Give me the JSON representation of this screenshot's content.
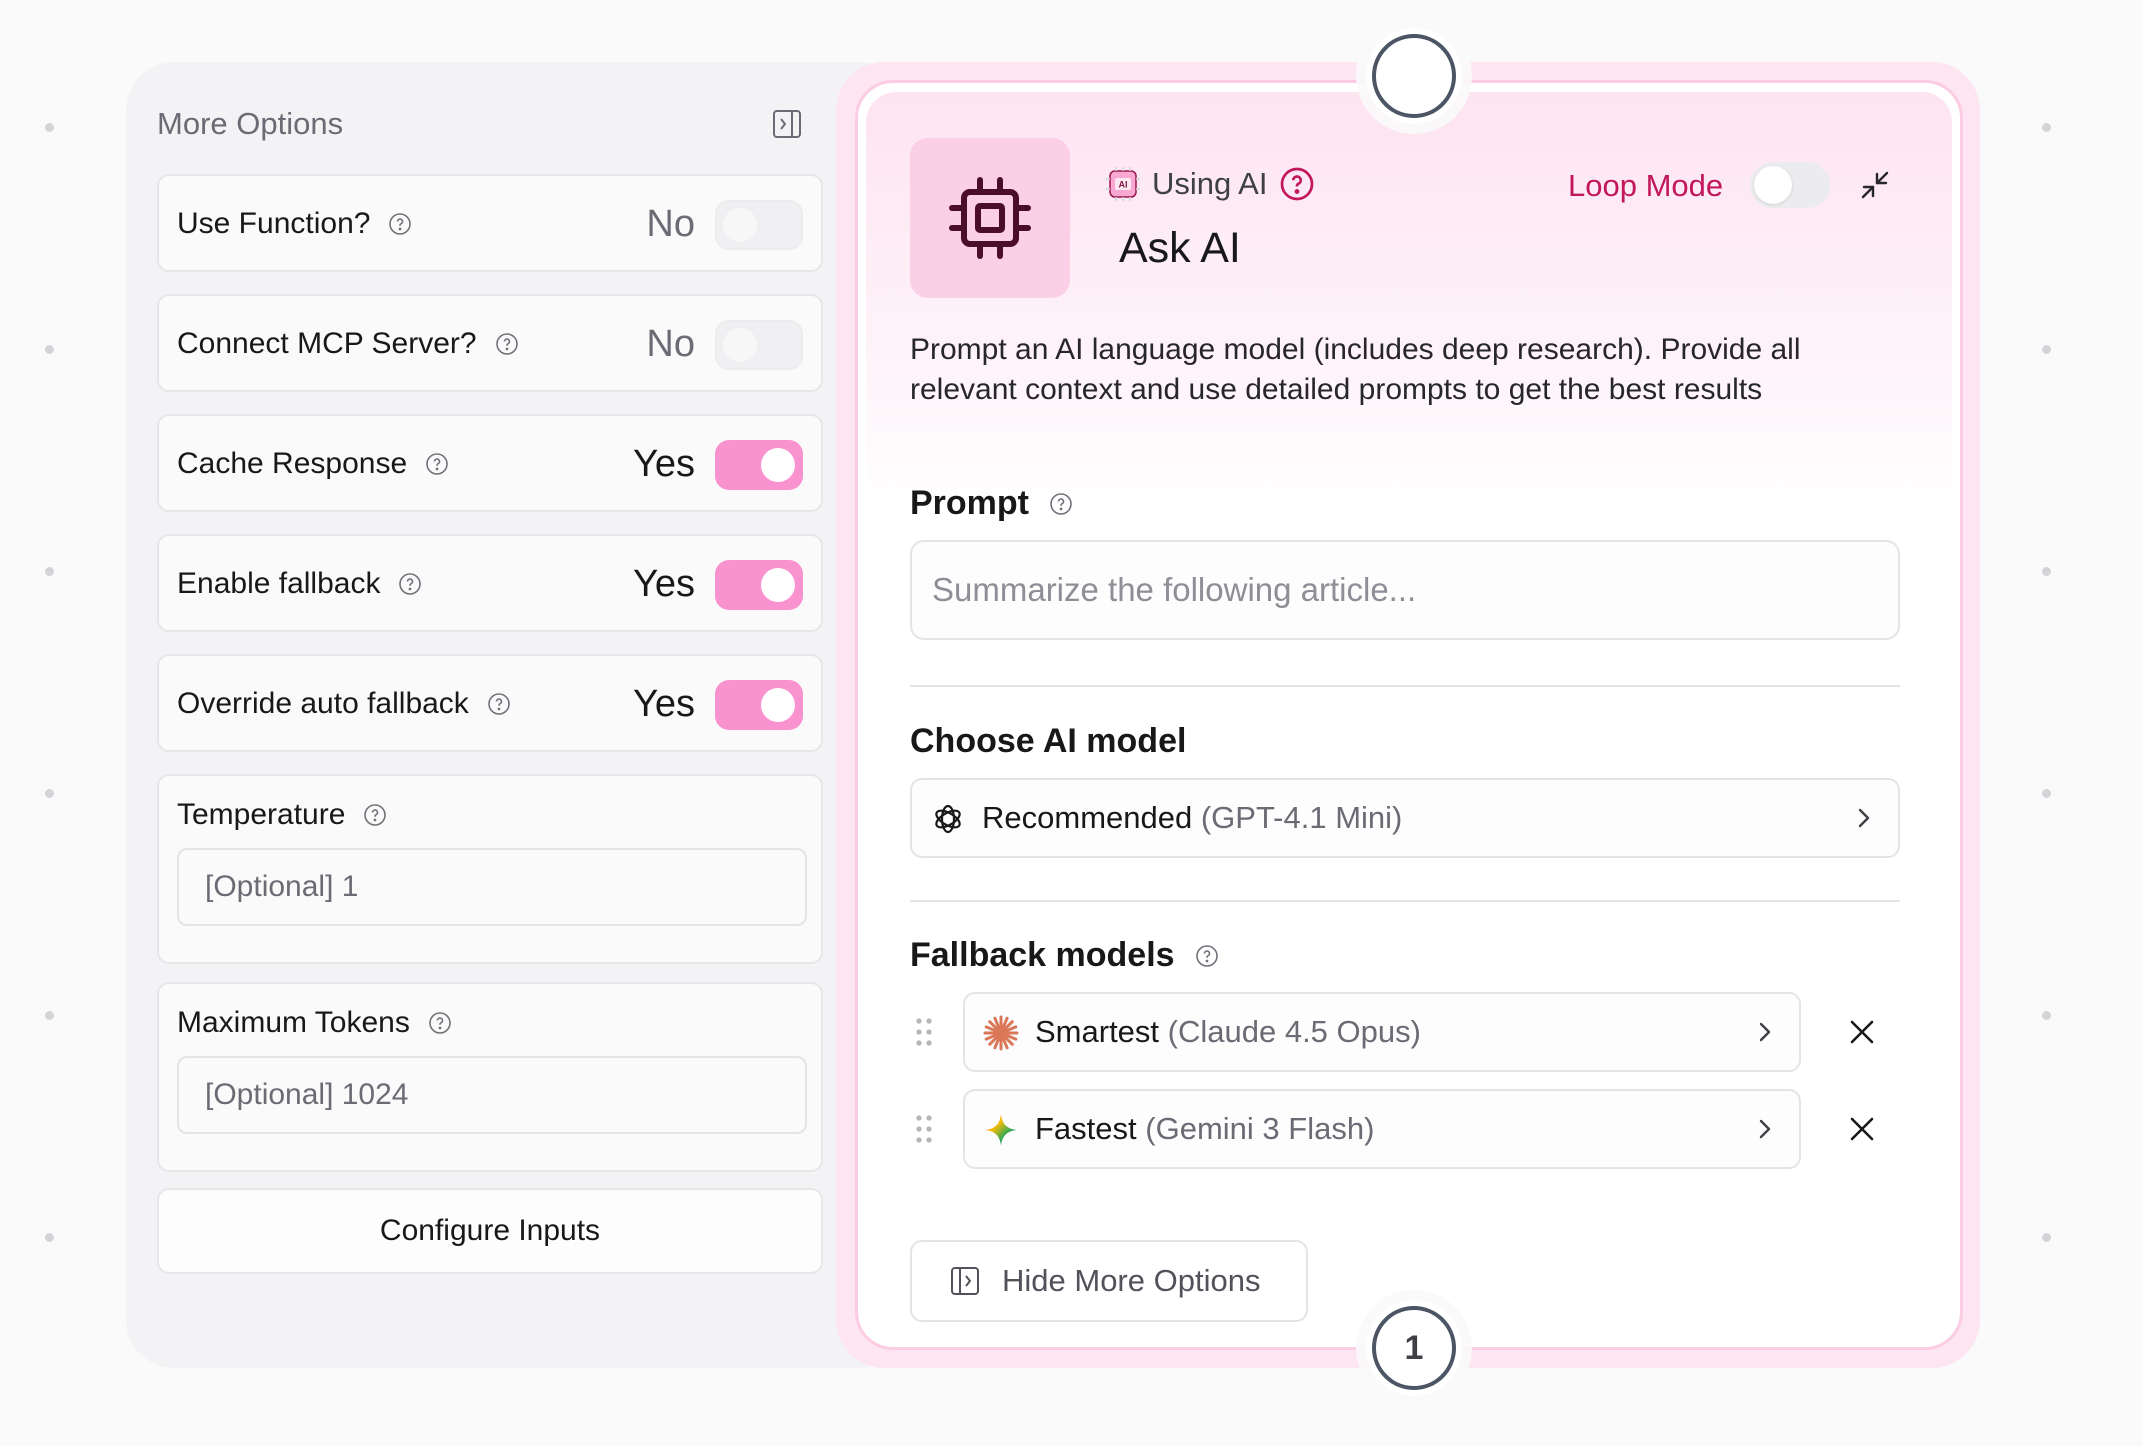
{
  "more_options": {
    "title": "More Options",
    "rows": [
      {
        "label": "Use Function?",
        "value": "No",
        "enabled": false
      },
      {
        "label": "Connect MCP Server?",
        "value": "No",
        "enabled": false
      },
      {
        "label": "Cache Response",
        "value": "Yes",
        "enabled": true
      },
      {
        "label": "Enable fallback",
        "value": "Yes",
        "enabled": true
      },
      {
        "label": "Override auto fallback",
        "value": "Yes",
        "enabled": true
      }
    ],
    "temperature": {
      "label": "Temperature",
      "placeholder": "[Optional] 1"
    },
    "max_tokens": {
      "label": "Maximum Tokens",
      "placeholder": "[Optional] 1024"
    },
    "configure_button": "Configure Inputs"
  },
  "node": {
    "using_label": "Using AI",
    "title": "Ask AI",
    "loop_mode_label": "Loop Mode",
    "loop_mode_enabled": false,
    "description": "Prompt an AI language model (includes deep research). Provide all relevant context and use detailed prompts to get the best results",
    "prompt": {
      "label": "Prompt",
      "placeholder": "Summarize the following article..."
    },
    "model": {
      "label": "Choose AI model",
      "name": "Recommended",
      "detail": "(GPT-4.1 Mini)"
    },
    "fallback": {
      "label": "Fallback models",
      "models": [
        {
          "name": "Smartest",
          "detail": "(Claude 4.5 Opus)",
          "icon": "claude-icon"
        },
        {
          "name": "Fastest",
          "detail": "(Gemini 3 Flash)",
          "icon": "gemini-icon"
        }
      ]
    },
    "hide_button": "Hide More Options",
    "step_number": "1"
  },
  "colors": {
    "accent_pink": "#f993cf",
    "loop_label": "#c2185b",
    "chip_tile": "#fbcfe6"
  }
}
